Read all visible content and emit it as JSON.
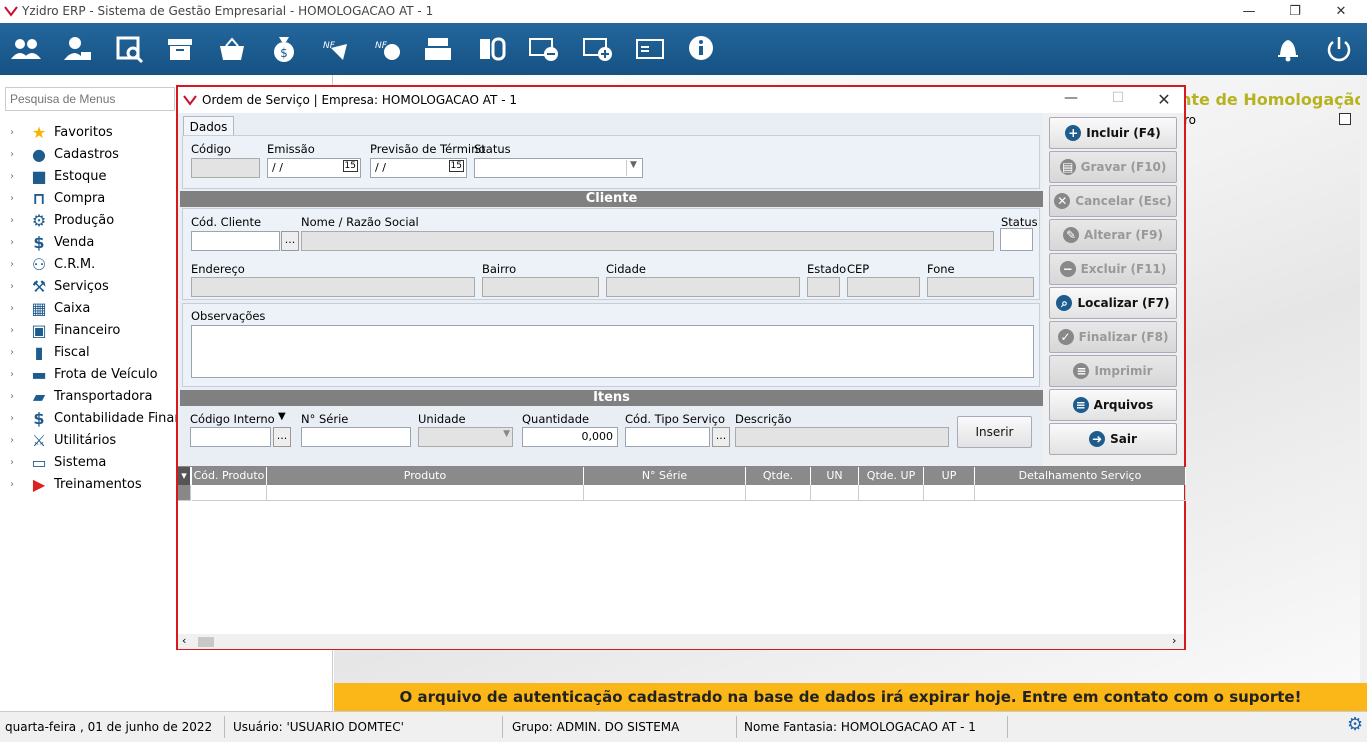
{
  "window": {
    "title": "Yzidro ERP - Sistema de Gestão Empresarial - HOMOLOGACAO AT - 1"
  },
  "toolbar_icons": [
    "people-icon",
    "user-card-icon",
    "search-register-icon",
    "archive-icon",
    "basket-icon",
    "money-bag-icon",
    "nfe-icon",
    "nfse-icon",
    "cash-register-icon",
    "split-coin-icon",
    "money-minus-icon",
    "money-plus-icon",
    "bill-icon",
    "info-icon",
    "bell-icon",
    "power-icon"
  ],
  "sidebar": {
    "search_placeholder": "Pesquisa de Menus",
    "items": [
      {
        "label": "Favoritos",
        "icon": "star-icon"
      },
      {
        "label": "Cadastros",
        "icon": "person-icon"
      },
      {
        "label": "Estoque",
        "icon": "box-icon"
      },
      {
        "label": "Compra",
        "icon": "basket-icon"
      },
      {
        "label": "Produção",
        "icon": "gear-icon"
      },
      {
        "label": "Venda",
        "icon": "money-bag-icon"
      },
      {
        "label": "C.R.M.",
        "icon": "crm-icon"
      },
      {
        "label": "Serviços",
        "icon": "hammer-icon"
      },
      {
        "label": "Caixa",
        "icon": "register-icon"
      },
      {
        "label": "Financeiro",
        "icon": "money-icon"
      },
      {
        "label": "Fiscal",
        "icon": "book-icon"
      },
      {
        "label": "Frota de Veículo",
        "icon": "car-icon"
      },
      {
        "label": "Transportadora",
        "icon": "truck-icon"
      },
      {
        "label": "Contabilidade Financ",
        "icon": "dollar-icon"
      },
      {
        "label": "Utilitários",
        "icon": "tools-icon"
      },
      {
        "label": "Sistema",
        "icon": "monitor-icon"
      },
      {
        "label": "Treinamentos",
        "icon": "youtube-icon"
      }
    ]
  },
  "background": {
    "env_label": "nte de Homologação",
    "ro_text": "ro"
  },
  "dialog": {
    "title": "Ordem de Serviço | Empresa: HOMOLOGACAO AT - 1",
    "tab": "Dados",
    "dados": {
      "codigo_label": "Código",
      "emissao_label": "Emissão",
      "emissao_value": "/ /",
      "previsao_label": "Previsão de Término",
      "previsao_value": "/ /",
      "status_label": "Status"
    },
    "cliente": {
      "band": "Cliente",
      "cod_label": "Cód. Cliente",
      "nome_label": "Nome / Razão Social",
      "status_label": "Status",
      "endereco_label": "Endereço",
      "bairro_label": "Bairro",
      "cidade_label": "Cidade",
      "estado_label": "Estado",
      "cep_label": "CEP",
      "fone_label": "Fone",
      "obs_label": "Observações"
    },
    "itens": {
      "band": "Itens",
      "codigo_label": "Código Interno",
      "serie_label": "N° Série",
      "unidade_label": "Unidade",
      "quantidade_label": "Quantidade",
      "quantidade_value": "0,000",
      "tipo_label": "Cód. Tipo Serviço",
      "descricao_label": "Descrição",
      "inserir": "Inserir"
    },
    "grid_columns": [
      "Cód. Produto",
      "Produto",
      "N° Série",
      "Qtde.",
      "UN",
      "Qtde. UP",
      "UP",
      "Detalhamento Serviço"
    ],
    "buttons": [
      {
        "label": "Incluir (F4)",
        "enabled": true,
        "icon": "plus-icon"
      },
      {
        "label": "Gravar (F10)",
        "enabled": false,
        "icon": "save-icon"
      },
      {
        "label": "Cancelar (Esc)",
        "enabled": false,
        "icon": "cancel-icon"
      },
      {
        "label": "Alterar (F9)",
        "enabled": false,
        "icon": "edit-icon"
      },
      {
        "label": "Excluir (F11)",
        "enabled": false,
        "icon": "minus-icon"
      },
      {
        "label": "Localizar (F7)",
        "enabled": true,
        "icon": "search-icon"
      },
      {
        "label": "Finalizar (F8)",
        "enabled": false,
        "icon": "check-icon"
      },
      {
        "label": "Imprimir",
        "enabled": false,
        "icon": "print-icon"
      },
      {
        "label": "Arquivos",
        "enabled": true,
        "icon": "document-icon"
      },
      {
        "label": "Sair",
        "enabled": true,
        "icon": "exit-icon"
      }
    ]
  },
  "warning": "O arquivo de autenticação cadastrado na base de dados irá expirar hoje. Entre em contato com o suporte!",
  "statusbar": {
    "date": "quarta-feira ,  01  de  junho  de  2022",
    "user": "Usuário: 'USUARIO DOMTEC'",
    "group": "Grupo: ADMIN. DO SISTEMA",
    "fantasy": "Nome Fantasia: HOMOLOGACAO AT - 1"
  }
}
